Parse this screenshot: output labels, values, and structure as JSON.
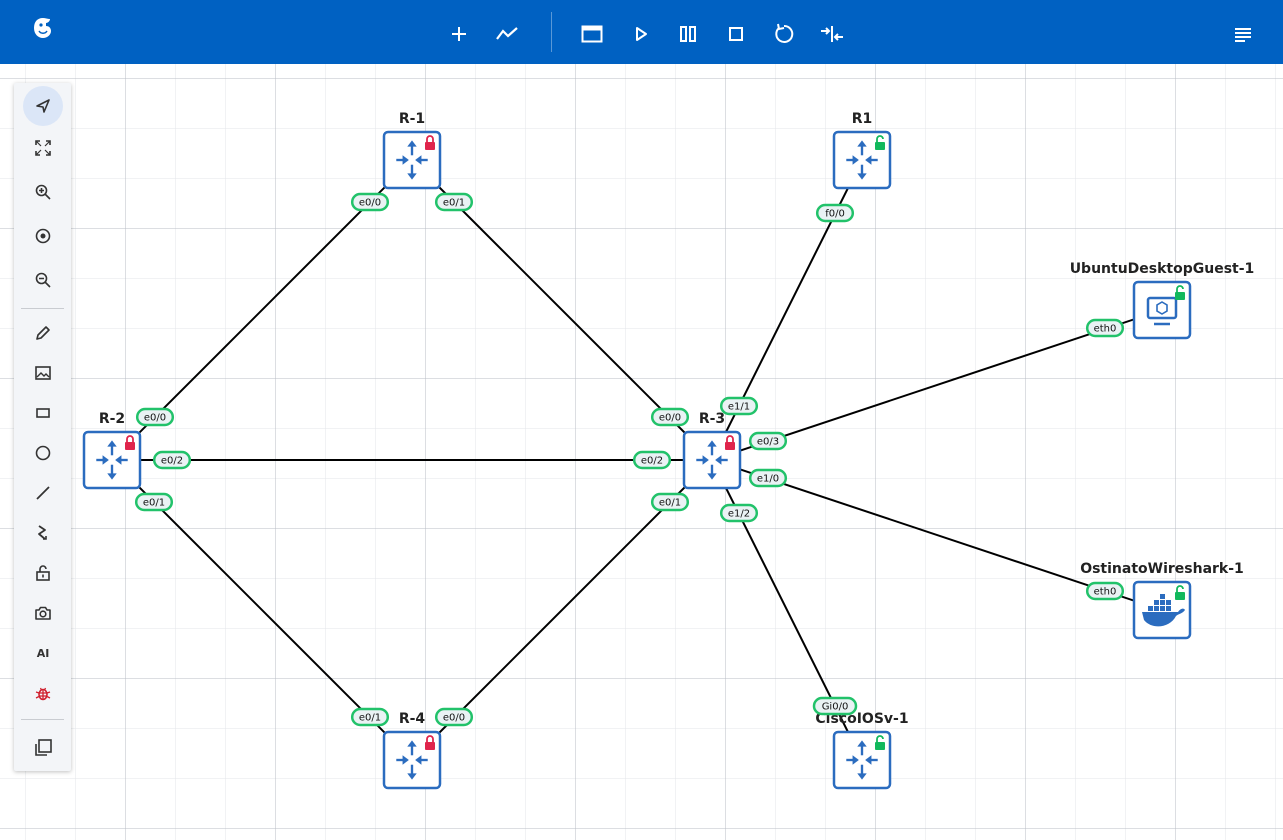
{
  "app": {
    "logo_icon": "cml-logo-icon",
    "accent_color": "#0061c2"
  },
  "toolbar": {
    "items": [
      {
        "name": "add-node-button",
        "icon": "plus-icon"
      },
      {
        "name": "stats-button",
        "icon": "line-chart-icon"
      },
      {
        "name": "console-button",
        "icon": "window-icon"
      },
      {
        "name": "start-button",
        "icon": "play-icon"
      },
      {
        "name": "pause-button",
        "icon": "pause-icon"
      },
      {
        "name": "stop-button",
        "icon": "stop-icon"
      },
      {
        "name": "reset-button",
        "icon": "rotate-icon"
      },
      {
        "name": "collapse-button",
        "icon": "collapse-arrows-icon"
      }
    ],
    "menu_icon": "menu-lines-icon"
  },
  "leftbar": {
    "items": [
      {
        "name": "select-tool",
        "icon": "pointer-icon",
        "active": true
      },
      {
        "name": "fit-view",
        "icon": "expand-icon"
      },
      {
        "name": "zoom-in",
        "icon": "zoom-in-icon"
      },
      {
        "name": "center-view",
        "icon": "target-icon"
      },
      {
        "name": "zoom-out",
        "icon": "zoom-out-icon"
      },
      {
        "name": "draw-pencil",
        "icon": "pencil-icon"
      },
      {
        "name": "insert-image",
        "icon": "image-icon"
      },
      {
        "name": "draw-rectangle",
        "icon": "rectangle-icon"
      },
      {
        "name": "draw-ellipse",
        "icon": "circle-icon"
      },
      {
        "name": "draw-line",
        "icon": "line-icon"
      },
      {
        "name": "draw-curve",
        "icon": "curve-icon"
      },
      {
        "name": "lock-toggle",
        "icon": "unlock-icon"
      },
      {
        "name": "screenshot",
        "icon": "camera-icon"
      },
      {
        "name": "ai-assistant",
        "icon": "ai-text-icon",
        "label": "AI"
      },
      {
        "name": "debug",
        "icon": "bug-icon"
      },
      {
        "name": "copy-layers",
        "icon": "copy-icon"
      }
    ]
  },
  "status_colors": {
    "locked_red": "#e0244b",
    "unlocked_green": "#12b85c",
    "port_border": "#22c26a",
    "node_blue": "#2b6cbf"
  },
  "nodes": [
    {
      "id": "R-1",
      "label": "R-1",
      "type": "router",
      "lock": "locked"
    },
    {
      "id": "R1",
      "label": "R1",
      "type": "router",
      "lock": "unlocked"
    },
    {
      "id": "R-2",
      "label": "R-2",
      "type": "router",
      "lock": "locked"
    },
    {
      "id": "R-3",
      "label": "R-3",
      "type": "router",
      "lock": "locked"
    },
    {
      "id": "R-4",
      "label": "R-4",
      "type": "router",
      "lock": "locked"
    },
    {
      "id": "UbuntuDesktopGuest-1",
      "label": "UbuntuDesktopGuest-1",
      "type": "desktop",
      "lock": "unlocked"
    },
    {
      "id": "OstinatoWireshark-1",
      "label": "OstinatoWireshark-1",
      "type": "docker",
      "lock": "unlocked"
    },
    {
      "id": "CiscoIOSv-1",
      "label": "CiscoIOSv-1",
      "type": "router",
      "lock": "unlocked"
    }
  ],
  "ports": [
    {
      "id": "p0",
      "label": "e0/0"
    },
    {
      "id": "p1",
      "label": "e0/1"
    },
    {
      "id": "p2",
      "label": "f0/0"
    },
    {
      "id": "p3",
      "label": "eth0"
    },
    {
      "id": "p4",
      "label": "e0/0"
    },
    {
      "id": "p5",
      "label": "e0/2"
    },
    {
      "id": "p6",
      "label": "e0/1"
    },
    {
      "id": "p7",
      "label": "e0/0"
    },
    {
      "id": "p8",
      "label": "e1/1"
    },
    {
      "id": "p9",
      "label": "e0/3"
    },
    {
      "id": "p10",
      "label": "e0/2"
    },
    {
      "id": "p11",
      "label": "e1/0"
    },
    {
      "id": "p12",
      "label": "e0/1"
    },
    {
      "id": "p13",
      "label": "e1/2"
    },
    {
      "id": "p14",
      "label": "eth0"
    },
    {
      "id": "p15",
      "label": "e0/1"
    },
    {
      "id": "p16",
      "label": "e0/0"
    },
    {
      "id": "p17",
      "label": "Gi0/0"
    }
  ]
}
